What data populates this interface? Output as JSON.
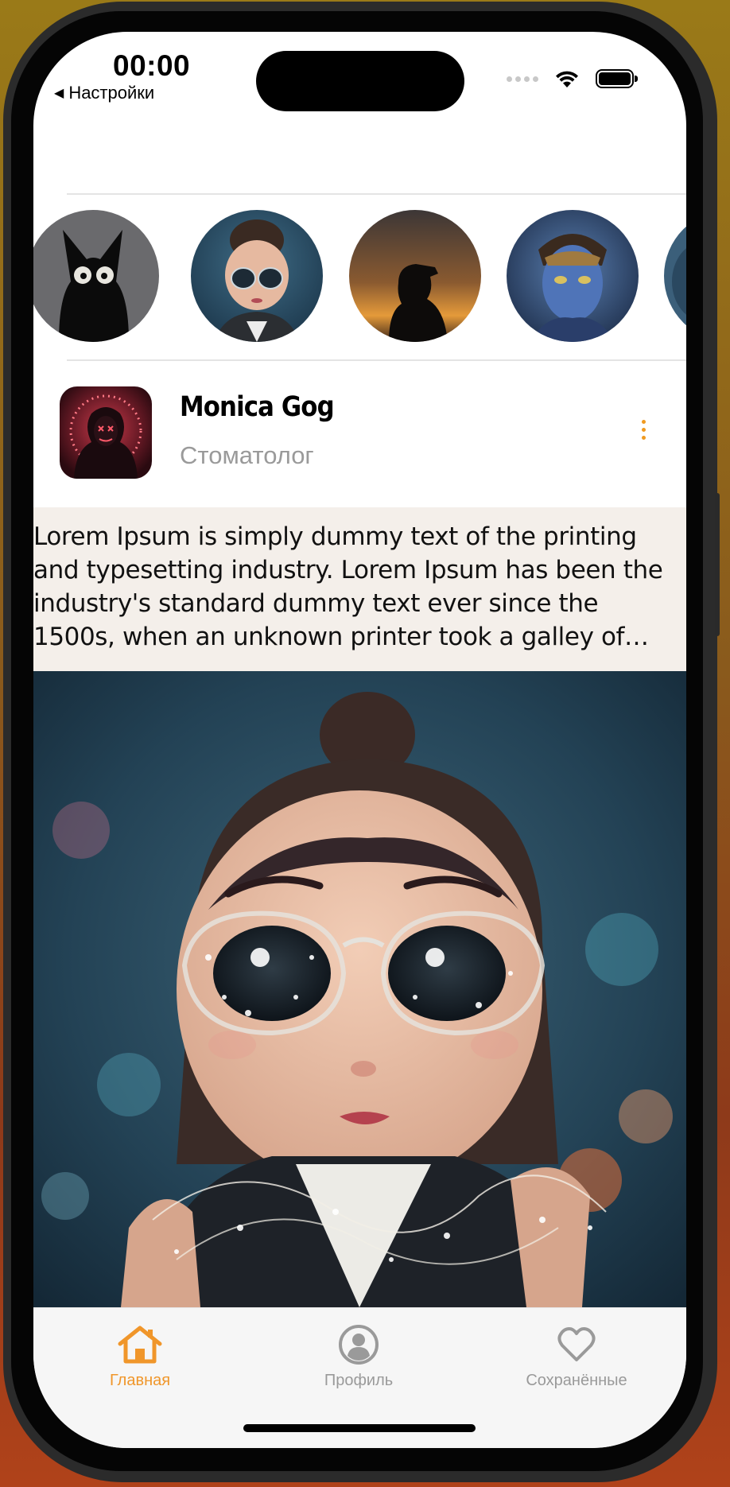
{
  "status_bar": {
    "time": "00:00",
    "back_label": "Настройки"
  },
  "stories": [
    {
      "icon": "black-cat-avatar"
    },
    {
      "icon": "cartoon-girl-glasses-avatar"
    },
    {
      "icon": "sunset-silhouette-avatar"
    },
    {
      "icon": "avatar-navi-avatar"
    },
    {
      "icon": "partial-avatar"
    }
  ],
  "post": {
    "author_name": "Monica Gog",
    "author_role": "Стоматолог",
    "text": "Lorem Ipsum is simply dummy text of the printing and typesetting industry. Lorem Ipsum has been the industry's standard dummy text ever since the 1500s, when an unknown printer took a galley of type and scrambled it to make a type specimen book.",
    "image": "cartoon-girl-with-fairy-lights"
  },
  "tab_bar": {
    "accent_color": "#f0962a",
    "inactive_color": "#9a9a9a",
    "tabs": [
      {
        "label": "Главная",
        "icon": "house-icon",
        "active": true
      },
      {
        "label": "Профиль",
        "icon": "person-circle-icon",
        "active": false
      },
      {
        "label": "Сохранённые",
        "icon": "heart-icon",
        "active": false
      }
    ]
  }
}
